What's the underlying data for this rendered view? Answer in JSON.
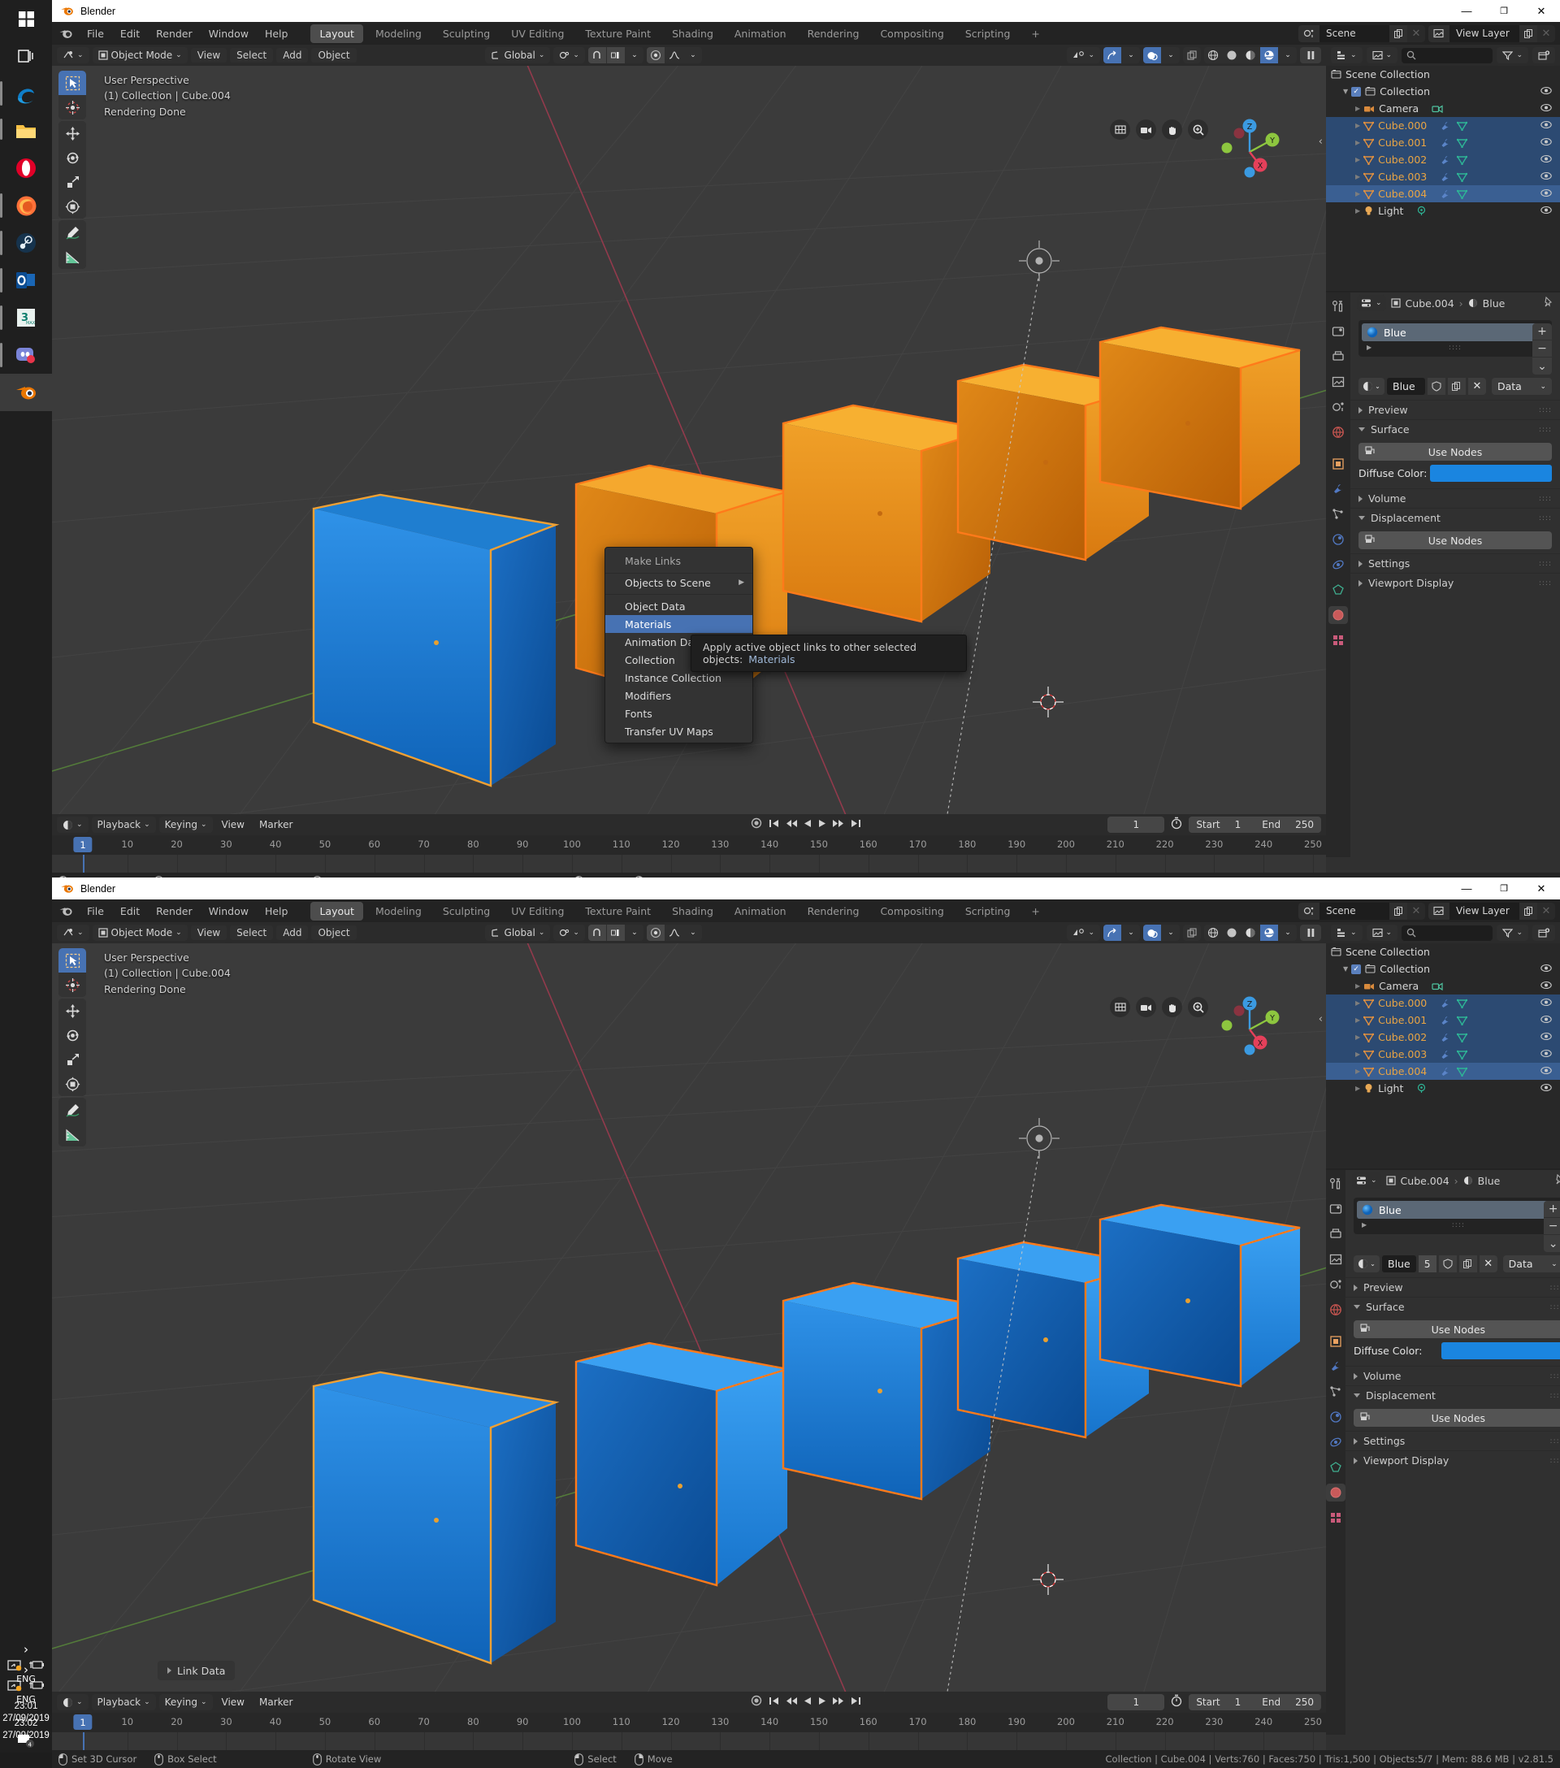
{
  "app": {
    "title": "Blender",
    "version_status": "v2.81.5"
  },
  "taskbar": {
    "icons": [
      "start-icon",
      "task-view-icon",
      "edge-icon",
      "file-explorer-icon",
      "opera-icon",
      "firefox-icon",
      "steam-icon",
      "outlook-icon",
      "3dsmax-icon",
      "discord-icon",
      "blender-icon"
    ],
    "tray": {
      "expand": "›",
      "lang": "ENG"
    },
    "clock_top": {
      "time": "23:01",
      "date": "27/09/2019"
    },
    "clock_bottom": {
      "time": "23:02",
      "date": "27/09/2019"
    }
  },
  "window": {
    "minimize": "—",
    "maximize": "❐",
    "close": "✕"
  },
  "topbar": {
    "menus": [
      "File",
      "Edit",
      "Render",
      "Window",
      "Help"
    ],
    "workspaces": [
      "Layout",
      "Modeling",
      "Sculpting",
      "UV Editing",
      "Texture Paint",
      "Shading",
      "Animation",
      "Rendering",
      "Compositing",
      "Scripting",
      "+"
    ],
    "active_workspace": "Layout",
    "scene_name": "Scene",
    "viewlayer_name": "View Layer"
  },
  "viewport_header": {
    "mode": "Object Mode",
    "menus": [
      "View",
      "Select",
      "Add",
      "Object"
    ],
    "transform_orientation": "Global"
  },
  "viewport": {
    "info_lines": [
      "User Perspective",
      "(1) Collection | Cube.004",
      "Rendering Done"
    ],
    "gizmo_axes": [
      "X",
      "Y",
      "Z"
    ],
    "nav_buttons": [
      "grid-toggle-icon",
      "camera-view-icon",
      "pan-view-icon",
      "zoom-view-icon"
    ],
    "tools": [
      "tweak-tool",
      "cursor-tool",
      "move-tool",
      "rotate-tool",
      "scale-tool",
      "transform-tool",
      "annotate-tool",
      "measure-tool"
    ]
  },
  "make_links_menu": {
    "title": "Make Links",
    "items": [
      {
        "label": "Objects to Scene",
        "accel": "O",
        "submenu": true,
        "highlight": false
      },
      {
        "label": "Object Data",
        "accel": "D",
        "submenu": false,
        "highlight": false
      },
      {
        "label": "Materials",
        "accel": "M",
        "submenu": false,
        "highlight": true
      },
      {
        "label": "Animation Data",
        "accel": "A",
        "submenu": false,
        "highlight": false
      },
      {
        "label": "Collection",
        "accel": "C",
        "submenu": false,
        "highlight": false
      },
      {
        "label": "Instance Collection",
        "accel": "In",
        "submenu": false,
        "highlight": false
      },
      {
        "label": "Modifiers",
        "accel": "e",
        "submenu": false,
        "highlight": false
      },
      {
        "label": "Fonts",
        "accel": "F",
        "submenu": false,
        "highlight": false
      },
      {
        "label": "Transfer UV Maps",
        "accel": "T",
        "submenu": false,
        "highlight": false
      }
    ],
    "tooltip": {
      "text": "Apply active object links to other selected objects:",
      "value": "Materials"
    }
  },
  "link_data_panel": {
    "label": "Link Data"
  },
  "outliner": {
    "display_mode": "view-layer-icon",
    "search_placeholder": "",
    "filter_icon": "filter-icon",
    "new_collection_icon": "new-collection-icon",
    "rows": [
      {
        "label": "Scene Collection",
        "icon": "collection-icon",
        "indent": 0,
        "state": "none",
        "eye": false
      },
      {
        "label": "Collection",
        "icon": "collection-icon",
        "indent": 1,
        "state": "none",
        "eye": true,
        "checkbox": true,
        "expander": "down"
      },
      {
        "label": "Camera",
        "icon": "camera-object-icon",
        "indent": 2,
        "state": "none",
        "eye": true,
        "datatype": "camera-data-icon"
      },
      {
        "label": "Cube.000",
        "icon": "mesh-object-icon",
        "indent": 2,
        "state": "selected",
        "eye": true,
        "datatype": "mesh-data-icon",
        "modifier": true
      },
      {
        "label": "Cube.001",
        "icon": "mesh-object-icon",
        "indent": 2,
        "state": "selected",
        "eye": true,
        "datatype": "mesh-data-icon",
        "modifier": true
      },
      {
        "label": "Cube.002",
        "icon": "mesh-object-icon",
        "indent": 2,
        "state": "selected",
        "eye": true,
        "datatype": "mesh-data-icon",
        "modifier": true
      },
      {
        "label": "Cube.003",
        "icon": "mesh-object-icon",
        "indent": 2,
        "state": "selected",
        "eye": true,
        "datatype": "mesh-data-icon",
        "modifier": true
      },
      {
        "label": "Cube.004",
        "icon": "mesh-object-icon",
        "indent": 2,
        "state": "active",
        "eye": true,
        "datatype": "mesh-data-icon",
        "modifier": true
      },
      {
        "label": "Light",
        "icon": "light-object-icon",
        "indent": 2,
        "state": "none",
        "eye": true,
        "datatype": "light-data-icon"
      }
    ]
  },
  "properties": {
    "breadcrumb_object": "Cube.004",
    "breadcrumb_material": "Blue",
    "material_slot": "Blue",
    "material_name": "Blue",
    "material_users_top": "",
    "material_users_bottom": "5",
    "data_dropdown": "Data",
    "panels": [
      {
        "label": "Preview",
        "open": false
      },
      {
        "label": "Surface",
        "open": true
      },
      {
        "label": "Volume",
        "open": false
      },
      {
        "label": "Displacement",
        "open": true
      },
      {
        "label": "Settings",
        "open": false
      },
      {
        "label": "Viewport Display",
        "open": false
      }
    ],
    "use_nodes_label": "Use Nodes",
    "diffuse_label": "Diffuse Color:",
    "diffuse_color": "#1a85e0",
    "slot_buttons": [
      "+",
      "−",
      "⌄"
    ],
    "tabs": [
      "tool-tab",
      "render-tab",
      "output-tab",
      "viewlayer-tab",
      "scene-tab",
      "world-tab",
      "object-tab",
      "modifier-tab",
      "particles-tab",
      "physics-tab",
      "constraint-tab",
      "data-tab",
      "material-tab",
      "texture-tab"
    ]
  },
  "timeline": {
    "editor_menus": [
      "Playback",
      "Keying",
      "View",
      "Marker"
    ],
    "current_frame": "1",
    "start_label": "Start",
    "start_value": "1",
    "end_label": "End",
    "end_value": "250",
    "ticks": [
      "10",
      "20",
      "30",
      "40",
      "50",
      "60",
      "70",
      "80",
      "90",
      "100",
      "110",
      "120",
      "130",
      "140",
      "150",
      "160",
      "170",
      "180",
      "190",
      "200",
      "210",
      "220",
      "230",
      "240",
      "250"
    ],
    "playhead_label": "1"
  },
  "statusbar": {
    "hints": [
      {
        "icon": "mouse-left-icon",
        "label": "Set 3D Cursor"
      },
      {
        "icon": "mouse-middle-icon",
        "label": "Box Select"
      },
      {
        "icon": "mouse-middle-icon",
        "label": "Rotate View"
      },
      {
        "icon": "mouse-left-icon",
        "label": "Select"
      },
      {
        "icon": "mouse-right-icon",
        "label": "Move"
      }
    ],
    "stats": "Collection | Cube.004 | Verts:760 | Faces:750 | Tris:1,500 | Objects:5/7 | Mem: 88.6 MB | v2.81.5"
  },
  "scene_3d": {
    "top_window_cube_colors": [
      "#1a7fd4",
      "#e8821e",
      "#f0a01e",
      "#e8821e",
      "#e8821e"
    ],
    "bottom_window_cube_colors": [
      "#1a7fd4",
      "#1a7fd4",
      "#2490e8",
      "#1a7fd4",
      "#1a7fd4"
    ],
    "selection_outline": "#e8821e",
    "active_outline": "#ffaf4d"
  }
}
